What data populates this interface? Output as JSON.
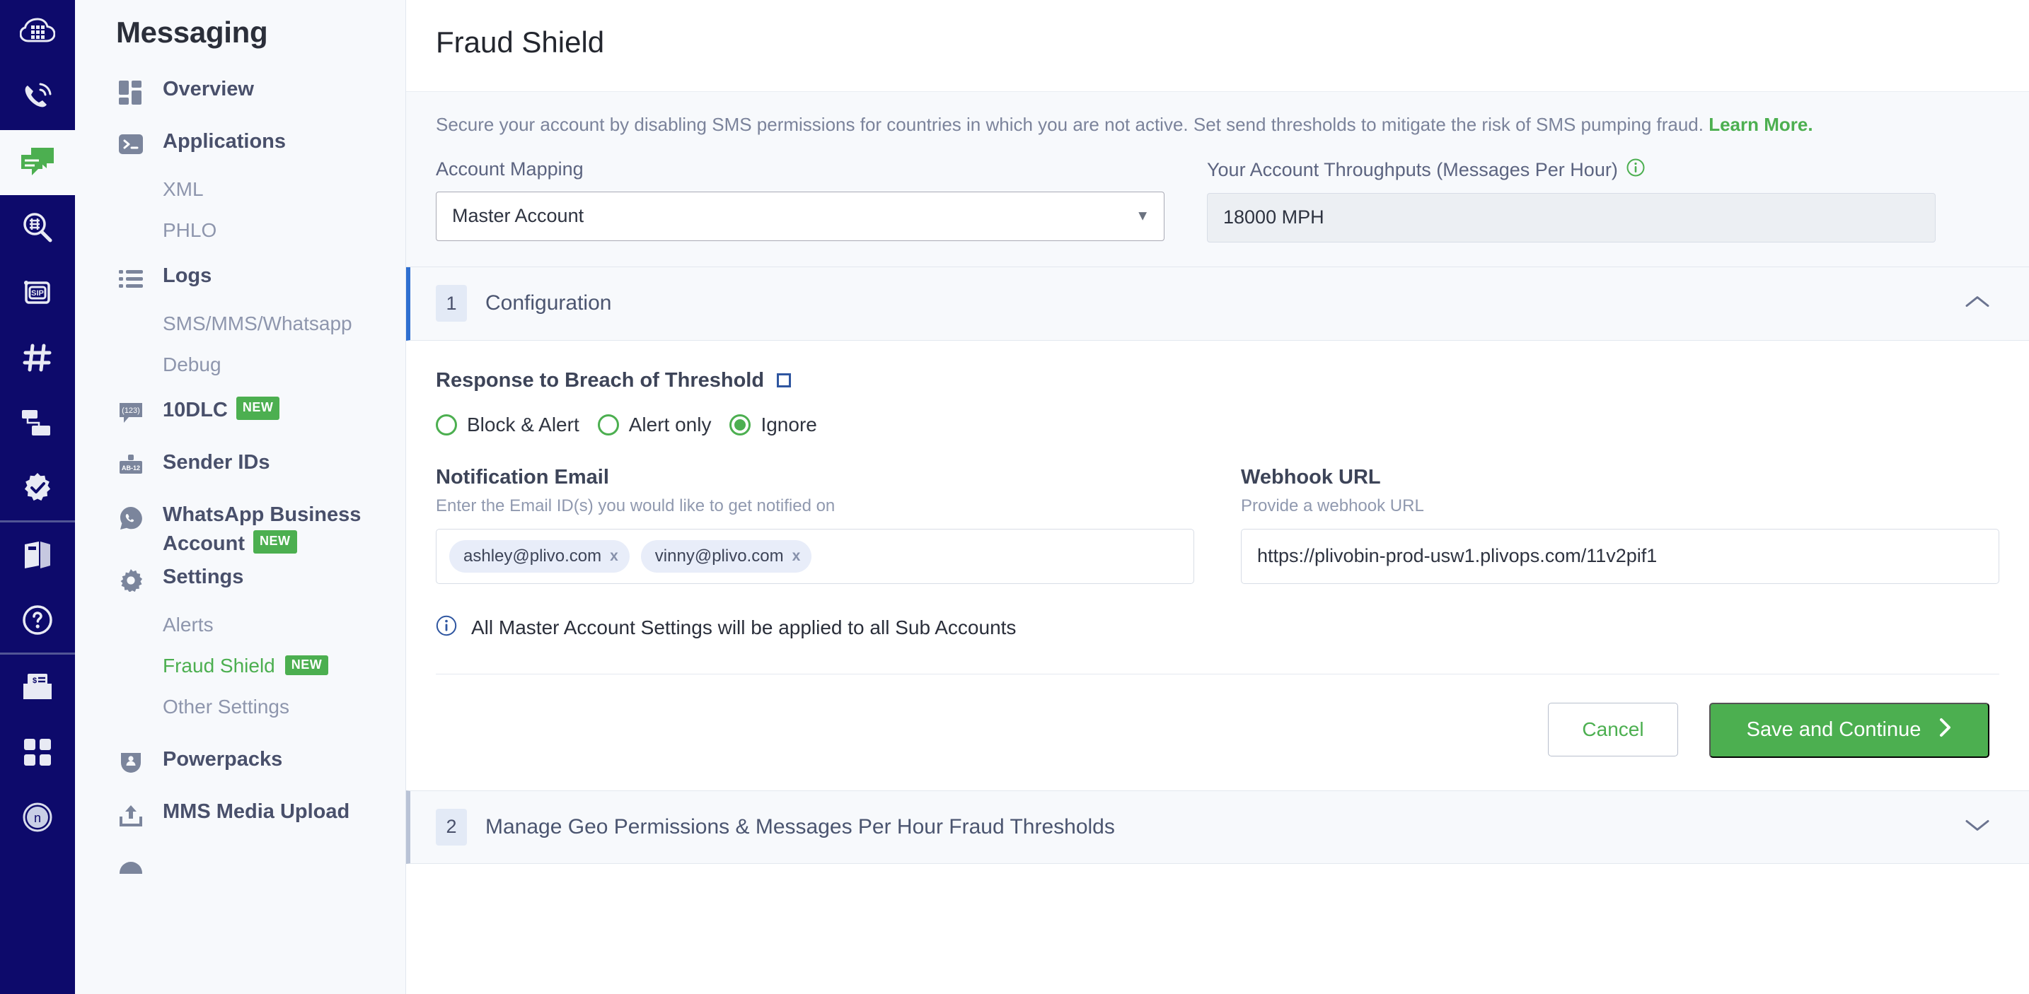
{
  "rail": {
    "items": [
      {
        "icon": "cloud-keypad-icon",
        "name": "rail-item-cloud",
        "active": false
      },
      {
        "icon": "phone-signal-icon",
        "name": "rail-item-voice",
        "active": false
      },
      {
        "icon": "messaging-bubbles-icon",
        "name": "rail-item-messaging",
        "active": true
      },
      {
        "icon": "lookup-search-icon",
        "name": "rail-item-lookup",
        "active": false
      },
      {
        "icon": "sip-trunk-icon",
        "name": "rail-item-sip",
        "active": false
      },
      {
        "icon": "hash-number-icon",
        "name": "rail-item-numbers",
        "active": false
      },
      {
        "icon": "flow-nodes-icon",
        "name": "rail-item-flows",
        "active": false
      },
      {
        "icon": "verify-badge-icon",
        "name": "rail-item-verify",
        "active": false
      },
      {
        "icon": "docs-book-icon",
        "name": "rail-item-docs",
        "active": false
      },
      {
        "icon": "help-question-icon",
        "name": "rail-item-help",
        "active": false
      },
      {
        "icon": "billing-envelope-icon",
        "name": "rail-item-billing",
        "active": false
      },
      {
        "icon": "apps-grid-icon",
        "name": "rail-item-apps",
        "active": false
      },
      {
        "icon": "account-avatar-icon",
        "name": "rail-item-account",
        "active": false
      }
    ]
  },
  "sidebar": {
    "title": "Messaging",
    "groups": [
      {
        "label": "Overview",
        "icon": "overview-blocks-icon",
        "name": "sidebar-item-overview",
        "badge": "",
        "children": []
      },
      {
        "label": "Applications",
        "icon": "terminal-icon",
        "name": "sidebar-item-applications",
        "badge": "",
        "children": [
          {
            "label": "XML",
            "name": "sidebar-subitem-xml",
            "active": false,
            "badge": ""
          },
          {
            "label": "PHLO",
            "name": "sidebar-subitem-phlo",
            "active": false,
            "badge": ""
          }
        ]
      },
      {
        "label": "Logs",
        "icon": "list-icon",
        "name": "sidebar-item-logs",
        "badge": "",
        "children": [
          {
            "label": "SMS/MMS/Whatsapp",
            "name": "sidebar-subitem-sms-mms-whatsapp",
            "active": false,
            "badge": ""
          },
          {
            "label": "Debug",
            "name": "sidebar-subitem-debug",
            "active": false,
            "badge": ""
          }
        ]
      },
      {
        "label": "10DLC",
        "icon": "dlc-bubble-icon",
        "name": "sidebar-item-10dlc",
        "badge": "NEW",
        "children": []
      },
      {
        "label": "Sender IDs",
        "icon": "sender-id-tag-icon",
        "name": "sidebar-item-sender-ids",
        "badge": "",
        "children": []
      },
      {
        "label": "WhatsApp Business Account",
        "icon": "whatsapp-icon",
        "name": "sidebar-item-whatsapp-business-account",
        "badge": "NEW",
        "children": []
      },
      {
        "label": "Settings",
        "icon": "gear-icon",
        "name": "sidebar-item-settings",
        "badge": "",
        "children": [
          {
            "label": "Alerts",
            "name": "sidebar-subitem-alerts",
            "active": false,
            "badge": ""
          },
          {
            "label": "Fraud Shield",
            "name": "sidebar-subitem-fraud-shield",
            "active": true,
            "badge": "NEW"
          },
          {
            "label": "Other Settings",
            "name": "sidebar-subitem-other-settings",
            "active": false,
            "badge": ""
          }
        ]
      },
      {
        "label": "Powerpacks",
        "icon": "powerpack-icon",
        "name": "sidebar-item-powerpacks",
        "badge": "",
        "children": []
      },
      {
        "label": "MMS Media Upload",
        "icon": "upload-icon",
        "name": "sidebar-item-mms-media-upload",
        "badge": "",
        "children": []
      }
    ]
  },
  "page": {
    "title": "Fraud Shield",
    "banner_text": "Secure your account by disabling SMS permissions for countries in which you are not active. Set send thresholds to mitigate the risk of SMS pumping fraud. ",
    "banner_link": "Learn More."
  },
  "account_mapping": {
    "label": "Account Mapping",
    "value": "Master Account",
    "options": [
      "Master Account"
    ]
  },
  "throughputs": {
    "label": "Your Account Throughputs (Messages Per Hour)",
    "info_icon": "info-circle-icon",
    "value": "18000 MPH"
  },
  "section1": {
    "number": "1",
    "title": "Configuration",
    "expanded": true,
    "chevron": "chevron-up-icon",
    "response_label": "Response to Breach of Threshold",
    "response_info_icon": "square-info-icon",
    "radios": [
      {
        "label": "Block & Alert",
        "selected": false,
        "name": "radio-block-and-alert"
      },
      {
        "label": "Alert only",
        "selected": false,
        "name": "radio-alert-only"
      },
      {
        "label": "Ignore",
        "selected": true,
        "name": "radio-ignore"
      }
    ],
    "notification_email": {
      "label": "Notification Email",
      "hint": "Enter the Email ID(s) you would like to get notified on",
      "chips": [
        "ashley@plivo.com",
        "vinny@plivo.com"
      ],
      "remove_glyph": "x"
    },
    "webhook": {
      "label": "Webhook URL",
      "hint": "Provide a webhook URL",
      "value": "https://plivobin-prod-usw1.plivops.com/11v2pif1",
      "placeholder": "Provide a webhook URL"
    },
    "note_icon": "info-circle-icon",
    "note": "All Master Account Settings will be applied to all Sub Accounts",
    "cancel_label": "Cancel",
    "save_label": "Save and Continue",
    "save_chevron": "chevron-right-icon"
  },
  "section2": {
    "number": "2",
    "title": "Manage Geo Permissions & Messages Per Hour Fraud Thresholds",
    "expanded": false,
    "chevron": "chevron-down-icon"
  },
  "colors": {
    "brand_green": "#4caf50",
    "rail_navy": "#0d0a6b",
    "accent_blue": "#2f6fd0",
    "sidebar_bg": "#f7f9fc"
  }
}
